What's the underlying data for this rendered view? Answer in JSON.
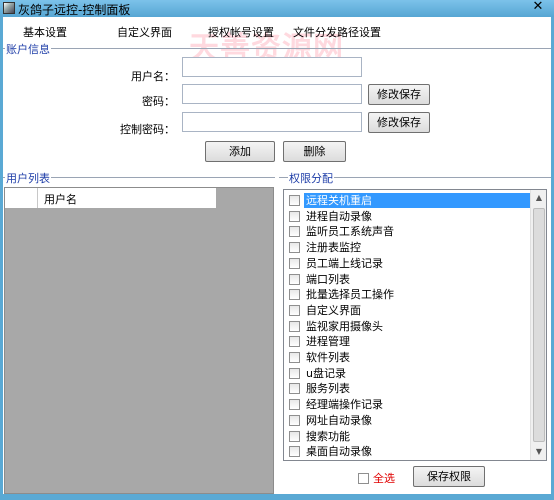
{
  "window": {
    "title": "灰鸽子远控-控制面板",
    "close_glyph": "✕",
    "watermark": "天善资源网"
  },
  "tabs": [
    "基本设置",
    "自定义界面",
    "授权帐号设置",
    "文件分发路径设置"
  ],
  "account": {
    "group_title": "账户信息",
    "username_label": "用户名：",
    "username_value": "",
    "password_label": "密码：",
    "password_value": "",
    "password_save": "修改保存",
    "control_password_label": "控制密码：",
    "control_password_value": "",
    "control_password_save": "修改保存",
    "add_button": "添加",
    "delete_button": "删除"
  },
  "user_list": {
    "group_title": "用户列表",
    "column_header": "用户名"
  },
  "permissions": {
    "group_title": "权限分配",
    "items": [
      "远程关机重启",
      "进程自动录像",
      "监听员工系统声音",
      "注册表监控",
      "员工端上线记录",
      "端口列表",
      "批量选择员工操作",
      "自定义界面",
      "监视家用摄像头",
      "进程管理",
      "软件列表",
      "u盘记录",
      "服务列表",
      "经理端操作记录",
      "网址自动录像",
      "搜索功能",
      "桌面自动录像"
    ],
    "selected_index": 0,
    "select_all_label": "全选",
    "save_button": "保存权限"
  },
  "colors": {
    "titlebar": "#56a6d3",
    "group_title": "#1f3ea8",
    "selection": "#3399ff",
    "select_all": "#e00000"
  }
}
